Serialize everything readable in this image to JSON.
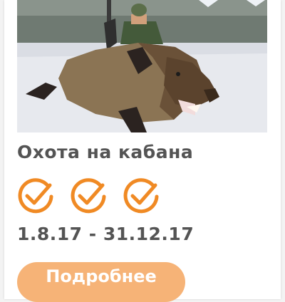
{
  "card": {
    "title": "Охота на кабана",
    "dates": "1.8.17 - 31.12.17",
    "button_label": "Подробнее",
    "checks": [
      {
        "icon": "check-circle-icon"
      },
      {
        "icon": "check-circle-icon"
      },
      {
        "icon": "check-circle-icon"
      }
    ],
    "image_icon": "boar-hunt-illustration"
  },
  "colors": {
    "accent": "#f08a24",
    "button_bg": "#f6b377",
    "text": "#545454",
    "card_bg": "#ffffff",
    "page_bg": "#f3f3f3"
  }
}
